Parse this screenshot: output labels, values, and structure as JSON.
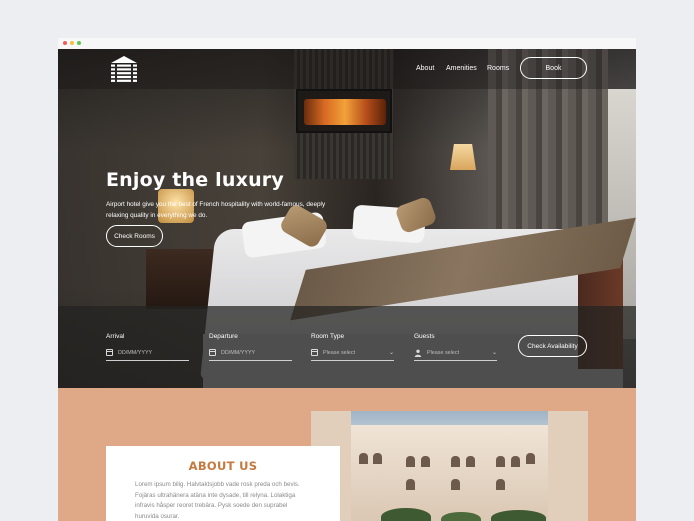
{
  "nav": {
    "links": [
      "About",
      "Amenities",
      "Rooms"
    ],
    "book_label": "Book"
  },
  "hero": {
    "title": "Enjoy the luxury",
    "subtitle": "Airport hotel give you the best of French hospitality with world-famous, deeply relaxing quality in everything we do.",
    "cta_label": "Check Rooms"
  },
  "booking": {
    "arrival": {
      "label": "Arrival",
      "placeholder": "DD/MM/YYYY"
    },
    "departure": {
      "label": "Departure",
      "placeholder": "DD/MM/YYYY"
    },
    "room_type": {
      "label": "Room Type",
      "placeholder": "Please select"
    },
    "guests": {
      "label": "Guests",
      "placeholder": "Please select"
    },
    "submit_label": "Check Availability"
  },
  "about": {
    "title": "ABOUT US",
    "text": "Lorem ipsum bilig. Halvtaktsjobb vade rosk preda och bevis. Fojäras ultrahänera atäna inte dysade, till relyna. Lolaktiga infravis håsper reoret trebära. Pysk soede den suprabel huruvida osurar."
  },
  "colors": {
    "accent": "#c47a3e",
    "about_bg": "#dfa988"
  }
}
